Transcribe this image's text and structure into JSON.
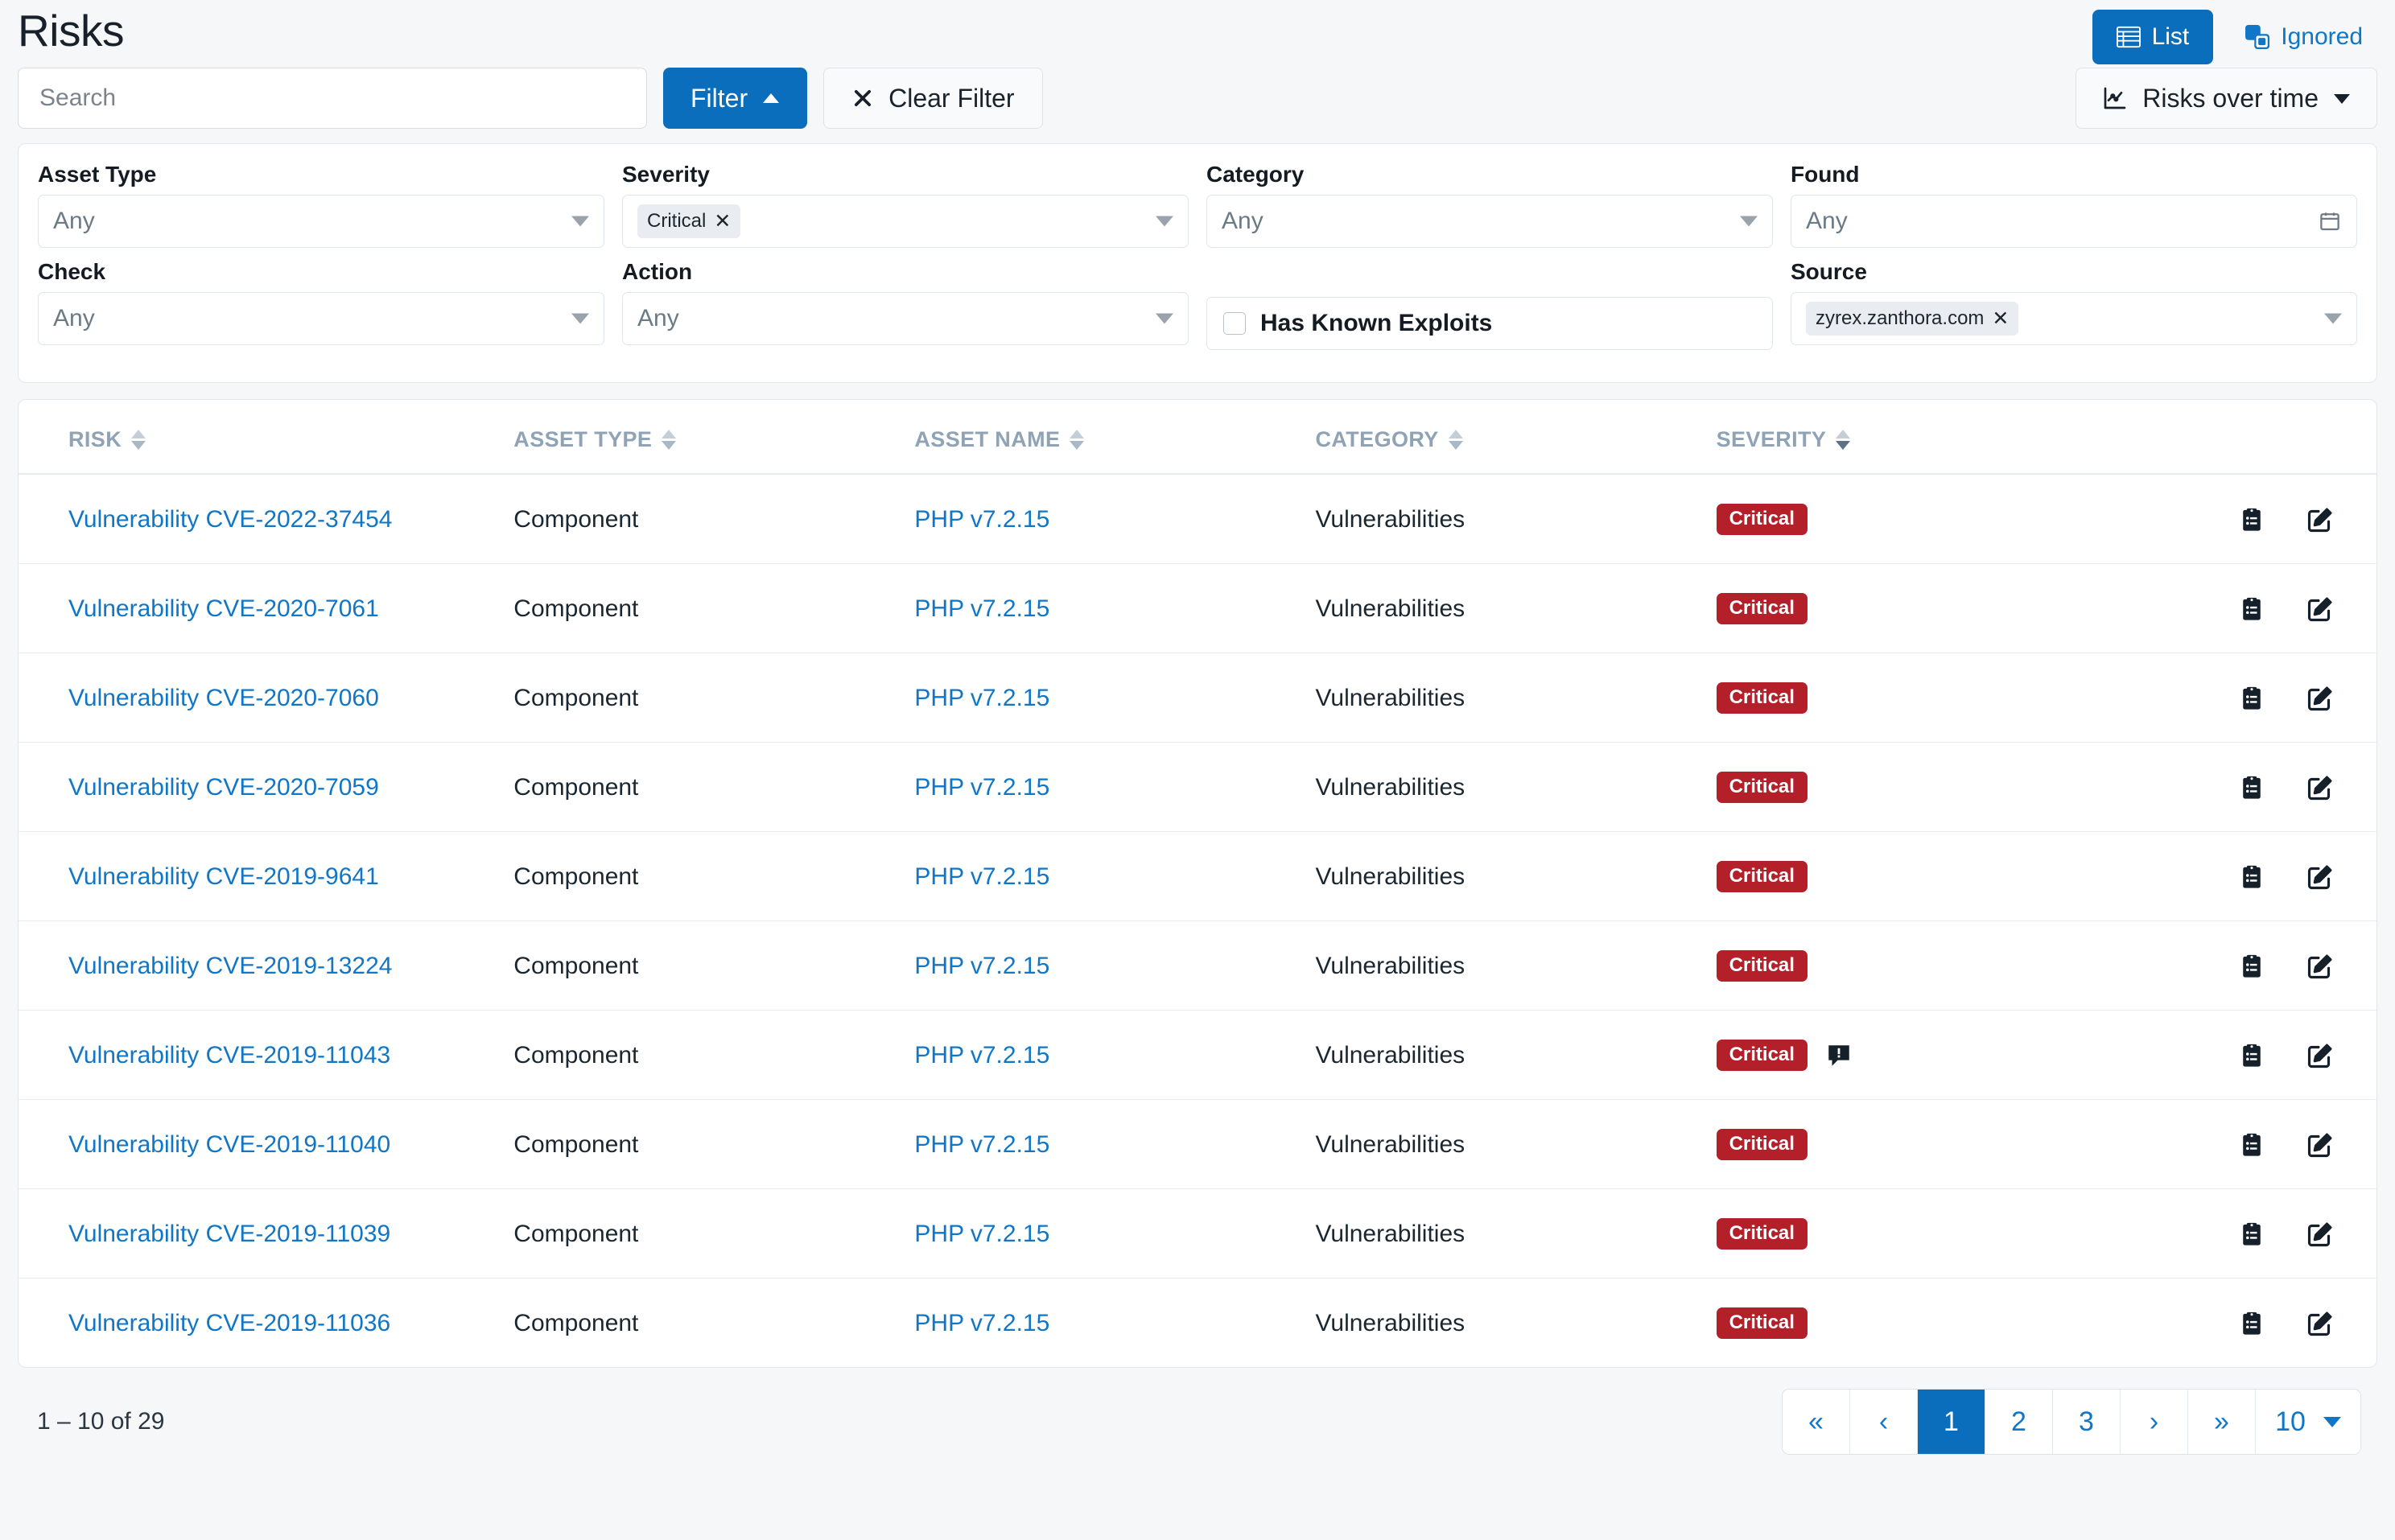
{
  "header": {
    "title": "Risks",
    "list_button": "List",
    "ignored_button": "Ignored"
  },
  "toolbar": {
    "search_placeholder": "Search",
    "search_value": "",
    "filter_button": "Filter",
    "clear_filter_button": "Clear Filter",
    "risks_over_time_button": "Risks over time"
  },
  "filters": {
    "asset_type": {
      "label": "Asset Type",
      "value": "Any"
    },
    "severity": {
      "label": "Severity",
      "chips": [
        "Critical"
      ]
    },
    "category": {
      "label": "Category",
      "value": "Any"
    },
    "found": {
      "label": "Found",
      "value": "Any"
    },
    "check": {
      "label": "Check",
      "value": "Any"
    },
    "action": {
      "label": "Action",
      "value": "Any"
    },
    "has_known_exploits": {
      "label": "Has Known Exploits",
      "checked": false
    },
    "source": {
      "label": "Source",
      "chips": [
        "zyrex.zanthora.com"
      ]
    }
  },
  "table": {
    "columns": [
      {
        "label": "RISK",
        "sort": "none"
      },
      {
        "label": "ASSET TYPE",
        "sort": "none"
      },
      {
        "label": "ASSET NAME",
        "sort": "none"
      },
      {
        "label": "CATEGORY",
        "sort": "none"
      },
      {
        "label": "SEVERITY",
        "sort": "desc"
      }
    ],
    "rows": [
      {
        "risk": "Vulnerability CVE-2022-37454",
        "asset_type": "Component",
        "asset_name": "PHP v7.2.15",
        "category": "Vulnerabilities",
        "severity": "Critical",
        "exploit_flag": false
      },
      {
        "risk": "Vulnerability CVE-2020-7061",
        "asset_type": "Component",
        "asset_name": "PHP v7.2.15",
        "category": "Vulnerabilities",
        "severity": "Critical",
        "exploit_flag": false
      },
      {
        "risk": "Vulnerability CVE-2020-7060",
        "asset_type": "Component",
        "asset_name": "PHP v7.2.15",
        "category": "Vulnerabilities",
        "severity": "Critical",
        "exploit_flag": false
      },
      {
        "risk": "Vulnerability CVE-2020-7059",
        "asset_type": "Component",
        "asset_name": "PHP v7.2.15",
        "category": "Vulnerabilities",
        "severity": "Critical",
        "exploit_flag": false
      },
      {
        "risk": "Vulnerability CVE-2019-9641",
        "asset_type": "Component",
        "asset_name": "PHP v7.2.15",
        "category": "Vulnerabilities",
        "severity": "Critical",
        "exploit_flag": false
      },
      {
        "risk": "Vulnerability CVE-2019-13224",
        "asset_type": "Component",
        "asset_name": "PHP v7.2.15",
        "category": "Vulnerabilities",
        "severity": "Critical",
        "exploit_flag": false
      },
      {
        "risk": "Vulnerability CVE-2019-11043",
        "asset_type": "Component",
        "asset_name": "PHP v7.2.15",
        "category": "Vulnerabilities",
        "severity": "Critical",
        "exploit_flag": true
      },
      {
        "risk": "Vulnerability CVE-2019-11040",
        "asset_type": "Component",
        "asset_name": "PHP v7.2.15",
        "category": "Vulnerabilities",
        "severity": "Critical",
        "exploit_flag": false
      },
      {
        "risk": "Vulnerability CVE-2019-11039",
        "asset_type": "Component",
        "asset_name": "PHP v7.2.15",
        "category": "Vulnerabilities",
        "severity": "Critical",
        "exploit_flag": false
      },
      {
        "risk": "Vulnerability CVE-2019-11036",
        "asset_type": "Component",
        "asset_name": "PHP v7.2.15",
        "category": "Vulnerabilities",
        "severity": "Critical",
        "exploit_flag": false
      }
    ]
  },
  "footer": {
    "range_text": "1 – 10 of 29",
    "pages": [
      "«",
      "‹",
      "1",
      "2",
      "3",
      "›",
      "»"
    ],
    "active_page": "1",
    "page_size": "10"
  },
  "colors": {
    "accent": "#0a6ebd",
    "link": "#1176c6",
    "critical": "#b3202a",
    "page_bg": "#f5f7f9"
  }
}
